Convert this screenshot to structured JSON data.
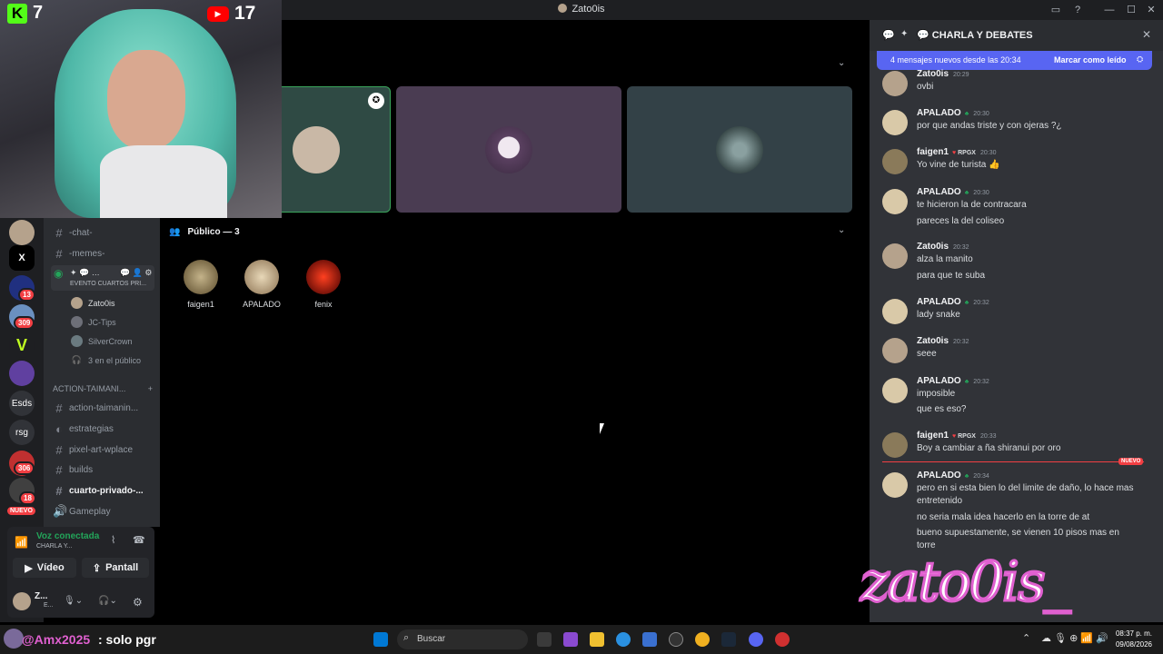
{
  "window": {
    "title": "Zato0is"
  },
  "counters": {
    "kick": "7",
    "youtube": "17"
  },
  "stage": {
    "audience_header": "Público — 3",
    "audience": [
      {
        "name": "faigen1",
        "color": "#8a7a5a"
      },
      {
        "name": "APALADO",
        "color": "#d9c9a8"
      },
      {
        "name": "fenix",
        "color": "#b02010"
      }
    ]
  },
  "channels": {
    "items": [
      {
        "label": "-chat-",
        "icon": "#"
      },
      {
        "label": "-memes-",
        "icon": "#"
      }
    ],
    "event_label": "EVENTO CUARTOS PRI...",
    "voice_users": [
      "Zato0is",
      "JC-Tips",
      "SilverCrown"
    ],
    "audience_count": "3 en el público",
    "category": "ACTION-TAIMANI...",
    "items2": [
      {
        "label": "action-taimanin...",
        "icon": "#"
      },
      {
        "label": "estrategias",
        "icon": "#"
      },
      {
        "label": "pixel-art-wplace",
        "icon": "#"
      },
      {
        "label": "builds",
        "icon": "#"
      },
      {
        "label": "cuarto-privado-...",
        "icon": "#"
      },
      {
        "label": "Gameplay",
        "icon": "speaker"
      }
    ]
  },
  "servers": {
    "x_label": "X",
    "esds_label": "Esds",
    "rsg_label": "rsg",
    "badges": [
      "13",
      "309",
      "306",
      "18"
    ],
    "nuevo": "NUEVO"
  },
  "voice_panel": {
    "status": "Voz conectada",
    "channel": "CHARLA Y...",
    "video_label": "Vídeo",
    "screen_label": "Pantall",
    "user": "Z...",
    "user_sub": "E..."
  },
  "chat": {
    "header": "CHARLA Y DEBATES",
    "new_messages": "4 mensajes nuevos desde las 20:34",
    "mark_read": "Marcar como leído",
    "nuevo_label": "NUEVO",
    "messages": [
      {
        "user": "Zato0is",
        "time": "20:29",
        "tag": "",
        "lines": [
          "ovbi"
        ]
      },
      {
        "user": "APALADO",
        "time": "20:30",
        "tag": "",
        "lines": [
          "por que andas triste y con ojeras ?¿"
        ]
      },
      {
        "user": "faigen1",
        "time": "20:30",
        "tag": "RPGX",
        "lines": [
          "Yo vine de turista 👍"
        ]
      },
      {
        "user": "APALADO",
        "time": "20:30",
        "tag": "",
        "lines": [
          "te hicieron la de contracara",
          "pareces la del coliseo"
        ]
      },
      {
        "user": "Zato0is",
        "time": "20:32",
        "tag": "",
        "lines": [
          "alza la manito",
          "para que te suba"
        ]
      },
      {
        "user": "APALADO",
        "time": "20:32",
        "tag": "",
        "lines": [
          "lady snake"
        ]
      },
      {
        "user": "Zato0is",
        "time": "20:32",
        "tag": "",
        "lines": [
          "seee"
        ]
      },
      {
        "user": "APALADO",
        "time": "20:32",
        "tag": "",
        "lines": [
          "imposible",
          "que es eso?"
        ]
      },
      {
        "user": "faigen1",
        "time": "20:33",
        "tag": "RPGX",
        "lines": [
          "Boy a cambiar a ña shiranui por oro"
        ]
      },
      {
        "user": "APALADO",
        "time": "20:34",
        "tag": "",
        "lines": [
          "pero en si esta bien lo del limite de daño, lo hace mas",
          "entretenido",
          "no seria mala idea hacerlo en la torre de at",
          "bueno supuestamente, se vienen 10 pisos mas en",
          "torre"
        ]
      }
    ]
  },
  "overlay": {
    "chat_user": "@Amx2025",
    "chat_text": ": solo pgr",
    "watermark": "zato0is_"
  },
  "taskbar": {
    "search": "Buscar",
    "time": "08:37 p. m.",
    "date": "09/08/2026"
  }
}
